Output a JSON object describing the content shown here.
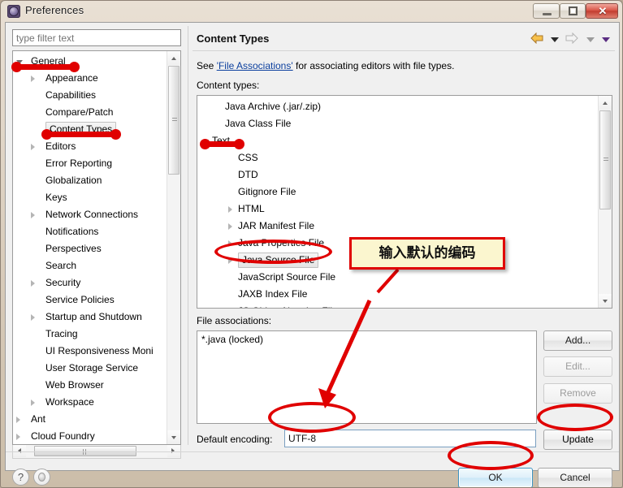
{
  "window": {
    "title": "Preferences",
    "icon": "gear-icon",
    "buttons": {
      "minimize": "minimize",
      "maximize": "maximize",
      "close": "✕"
    }
  },
  "sidebar": {
    "filter": {
      "placeholder": "type filter text",
      "value": ""
    },
    "items": [
      {
        "label": "General",
        "indent": 0,
        "expander": "open",
        "selected": false
      },
      {
        "label": "Appearance",
        "indent": 1,
        "expander": "closed",
        "selected": false
      },
      {
        "label": "Capabilities",
        "indent": 1,
        "expander": "none",
        "selected": false
      },
      {
        "label": "Compare/Patch",
        "indent": 1,
        "expander": "none",
        "selected": false
      },
      {
        "label": "Content Types",
        "indent": 1,
        "expander": "none",
        "selected": true
      },
      {
        "label": "Editors",
        "indent": 1,
        "expander": "closed",
        "selected": false
      },
      {
        "label": "Error Reporting",
        "indent": 1,
        "expander": "none",
        "selected": false
      },
      {
        "label": "Globalization",
        "indent": 1,
        "expander": "none",
        "selected": false
      },
      {
        "label": "Keys",
        "indent": 1,
        "expander": "none",
        "selected": false
      },
      {
        "label": "Network Connections",
        "indent": 1,
        "expander": "closed",
        "selected": false
      },
      {
        "label": "Notifications",
        "indent": 1,
        "expander": "none",
        "selected": false
      },
      {
        "label": "Perspectives",
        "indent": 1,
        "expander": "none",
        "selected": false
      },
      {
        "label": "Search",
        "indent": 1,
        "expander": "none",
        "selected": false
      },
      {
        "label": "Security",
        "indent": 1,
        "expander": "closed",
        "selected": false
      },
      {
        "label": "Service Policies",
        "indent": 1,
        "expander": "none",
        "selected": false
      },
      {
        "label": "Startup and Shutdown",
        "indent": 1,
        "expander": "closed",
        "selected": false
      },
      {
        "label": "Tracing",
        "indent": 1,
        "expander": "none",
        "selected": false
      },
      {
        "label": "UI Responsiveness Moni",
        "indent": 1,
        "expander": "none",
        "selected": false
      },
      {
        "label": "User Storage Service",
        "indent": 1,
        "expander": "none",
        "selected": false
      },
      {
        "label": "Web Browser",
        "indent": 1,
        "expander": "none",
        "selected": false
      },
      {
        "label": "Workspace",
        "indent": 1,
        "expander": "closed",
        "selected": false
      },
      {
        "label": "Ant",
        "indent": 0,
        "expander": "closed",
        "selected": false
      },
      {
        "label": "Cloud Foundry",
        "indent": 0,
        "expander": "closed",
        "selected": false
      }
    ]
  },
  "page": {
    "title": "Content Types",
    "nav": {
      "back_icon": "back-arrow-icon",
      "back_menu_icon": "chevron-down-icon",
      "forward_icon": "forward-arrow-icon",
      "forward_menu_icon": "chevron-down-icon",
      "view_menu_icon": "chevron-down-icon"
    },
    "description_prefix": "See ",
    "description_link": "'File Associations'",
    "description_suffix": " for associating editors with file types.",
    "content_types_label": "Content types:",
    "content_types": [
      {
        "label": "Java Archive (.jar/.zip)",
        "indent": 1,
        "expander": "none",
        "selected": false
      },
      {
        "label": "Java Class File",
        "indent": 1,
        "expander": "none",
        "selected": false
      },
      {
        "label": "Text",
        "indent": 0,
        "expander": "open",
        "selected": false
      },
      {
        "label": "CSS",
        "indent": 2,
        "expander": "none",
        "selected": false
      },
      {
        "label": "DTD",
        "indent": 2,
        "expander": "none",
        "selected": false
      },
      {
        "label": "Gitignore File",
        "indent": 2,
        "expander": "none",
        "selected": false
      },
      {
        "label": "HTML",
        "indent": 2,
        "expander": "closed",
        "selected": false
      },
      {
        "label": "JAR Manifest File",
        "indent": 2,
        "expander": "closed",
        "selected": false
      },
      {
        "label": "Java Properties File",
        "indent": 2,
        "expander": "closed",
        "selected": false
      },
      {
        "label": "Java Source File",
        "indent": 2,
        "expander": "closed",
        "selected": true
      },
      {
        "label": "JavaScript Source File",
        "indent": 2,
        "expander": "none",
        "selected": false
      },
      {
        "label": "JAXB Index File",
        "indent": 2,
        "expander": "none",
        "selected": false
      },
      {
        "label": "JS Object Notation File",
        "indent": 2,
        "expander": "none",
        "selected": false
      }
    ],
    "file_associations_label": "File associations:",
    "file_associations": [
      "*.java (locked)"
    ],
    "buttons": {
      "add": "Add...",
      "edit": "Edit...",
      "remove": "Remove",
      "update": "Update"
    },
    "default_encoding_label": "Default encoding:",
    "default_encoding_value": "UTF-8"
  },
  "footer": {
    "help_icon": "question-mark-icon",
    "restore_icon": "restore-defaults-icon",
    "ok": "OK",
    "cancel": "Cancel"
  },
  "annotation": {
    "callout_text": "输入默认的编码",
    "color": "#e00000",
    "callout_bg": "#fbf6cf"
  }
}
